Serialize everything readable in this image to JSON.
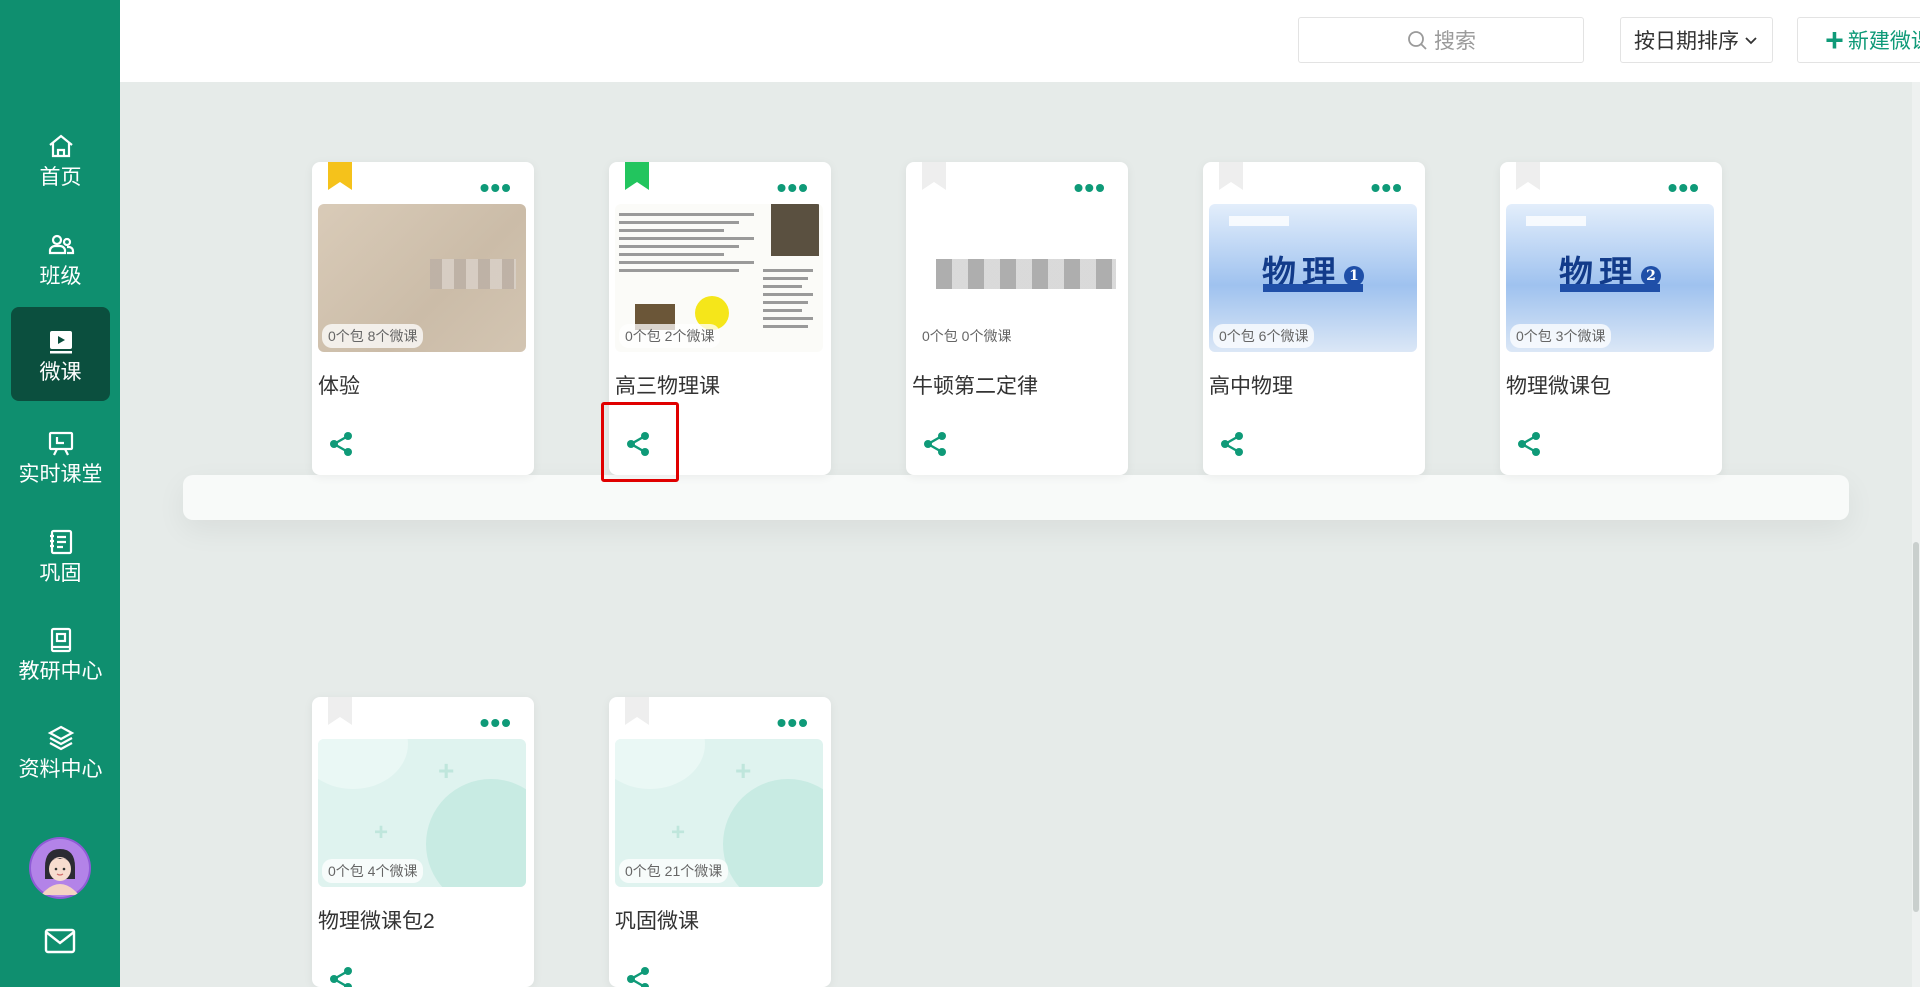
{
  "sidebar": {
    "items": [
      {
        "label": "首页",
        "icon": "home-icon"
      },
      {
        "label": "班级",
        "icon": "users-icon"
      },
      {
        "label": "微课",
        "icon": "microcourse-icon",
        "active": true
      },
      {
        "label": "实时课堂",
        "icon": "live-class-icon"
      },
      {
        "label": "巩固",
        "icon": "notebook-icon"
      },
      {
        "label": "教研中心",
        "icon": "research-book-icon"
      },
      {
        "label": "资料中心",
        "icon": "layers-icon"
      }
    ],
    "avatar": "user-avatar",
    "mail_icon": "mail-icon"
  },
  "toolbar": {
    "search_placeholder": "搜索",
    "sort_label": "按日期排序",
    "new_label": "新建微课包"
  },
  "cards": [
    {
      "title": "体验",
      "counts": "0个包  8个微课",
      "bookmark_color": "#f5c21b",
      "cover": "beige"
    },
    {
      "title": "高三物理课",
      "counts": "0个包  2个微课",
      "bookmark_color": "#22c55e",
      "cover": "paper",
      "share_highlighted": true
    },
    {
      "title": "牛顿第二定律",
      "counts": "0个包  0个微课",
      "bookmark_color": "#eeeeee",
      "cover": "white"
    },
    {
      "title": "高中物理",
      "counts": "0个包  6个微课",
      "bookmark_color": "#eeeeee",
      "cover": "physics",
      "cover_text": "物理",
      "cover_number": "1"
    },
    {
      "title": "物理微课包",
      "counts": "0个包  3个微课",
      "bookmark_color": "#eeeeee",
      "cover": "physics",
      "cover_text": "物理",
      "cover_number": "2"
    },
    {
      "title": "物理微课包2",
      "counts": "0个包  4个微课",
      "bookmark_color": "#eeeeee",
      "cover": "mint"
    },
    {
      "title": "巩固微课",
      "counts": "0个包  21个微课",
      "bookmark_color": "#eeeeee",
      "cover": "mint"
    }
  ],
  "colors": {
    "sidebar": "#0f8f6f",
    "accent": "#0f9a78",
    "highlight": "#e00000"
  }
}
